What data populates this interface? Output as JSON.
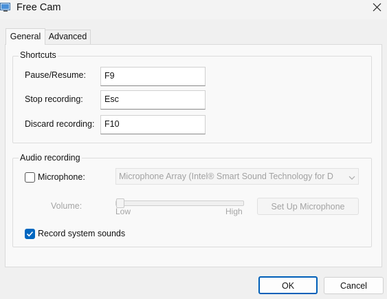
{
  "window": {
    "title": "Free Cam",
    "app_icon": "monitor-app-icon",
    "close_icon": "close-icon"
  },
  "tabs": [
    {
      "label": "General",
      "active": true
    },
    {
      "label": "Advanced",
      "active": false
    }
  ],
  "shortcuts": {
    "title": "Shortcuts",
    "pause_label": "Pause/Resume:",
    "pause_value": "F9",
    "stop_label": "Stop recording:",
    "stop_value": "Esc",
    "discard_label": "Discard recording:",
    "discard_value": "F10"
  },
  "audio": {
    "title": "Audio recording",
    "microphone_label": "Microphone:",
    "microphone_checked": false,
    "microphone_device": "Microphone Array (Intel® Smart Sound Technology for D",
    "volume_label": "Volume:",
    "volume_level": 0,
    "low_label": "Low",
    "high_label": "High",
    "setup_button": "Set Up Microphone",
    "system_sounds_label": "Record system sounds",
    "system_sounds_checked": true
  },
  "footer": {
    "ok": "OK",
    "cancel": "Cancel"
  },
  "colors": {
    "accent": "#0067c0",
    "ok_border": "#005fb8",
    "background": "#f0f0f0"
  }
}
